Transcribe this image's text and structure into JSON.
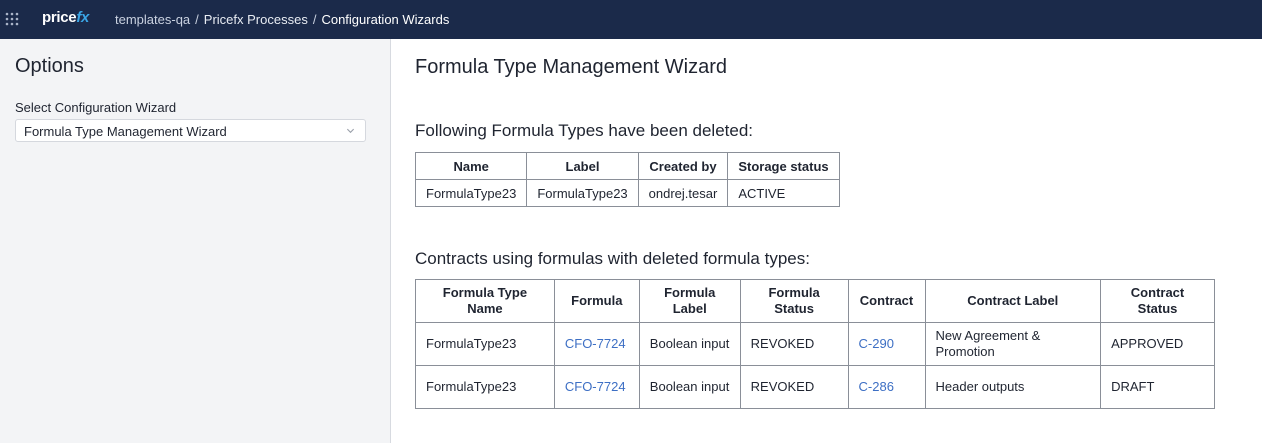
{
  "topbar": {
    "logo_main": "price",
    "logo_accent": "fx",
    "breadcrumb": [
      "templates-qa",
      "Pricefx Processes",
      "Configuration Wizards"
    ],
    "separator": "/"
  },
  "sidebar": {
    "title": "Options",
    "select_label": "Select Configuration Wizard",
    "select_value": "Formula Type Management Wizard"
  },
  "main": {
    "title": "Formula Type Management Wizard",
    "deleted_heading": "Following Formula Types have been deleted:",
    "deleted_table": {
      "headers": [
        "Name",
        "Label",
        "Created by",
        "Storage status"
      ],
      "rows": [
        [
          "FormulaType23",
          "FormulaType23",
          "ondrej.tesar",
          "ACTIVE"
        ]
      ]
    },
    "contracts_heading": "Contracts using formulas with deleted formula types:",
    "contracts_table": {
      "headers": [
        "Formula Type Name",
        "Formula",
        "Formula Label",
        "Formula Status",
        "Contract",
        "Contract Label",
        "Contract Status"
      ],
      "rows": [
        [
          "FormulaType23",
          "CFO-7724",
          "Boolean input",
          "REVOKED",
          "C-290",
          "New Agreement & Promotion",
          "APPROVED"
        ],
        [
          "FormulaType23",
          "CFO-7724",
          "Boolean input",
          "REVOKED",
          "C-286",
          "Header outputs",
          "DRAFT"
        ]
      ]
    }
  },
  "colors": {
    "topbar_bg": "#1b2a4a",
    "logo_accent": "#3aa5e6",
    "link": "#3d6fc4",
    "sidebar_bg": "#f3f4f6"
  },
  "icons": {
    "app_menu": "grid-dots-icon",
    "select_chevron": "chevron-down-icon"
  }
}
